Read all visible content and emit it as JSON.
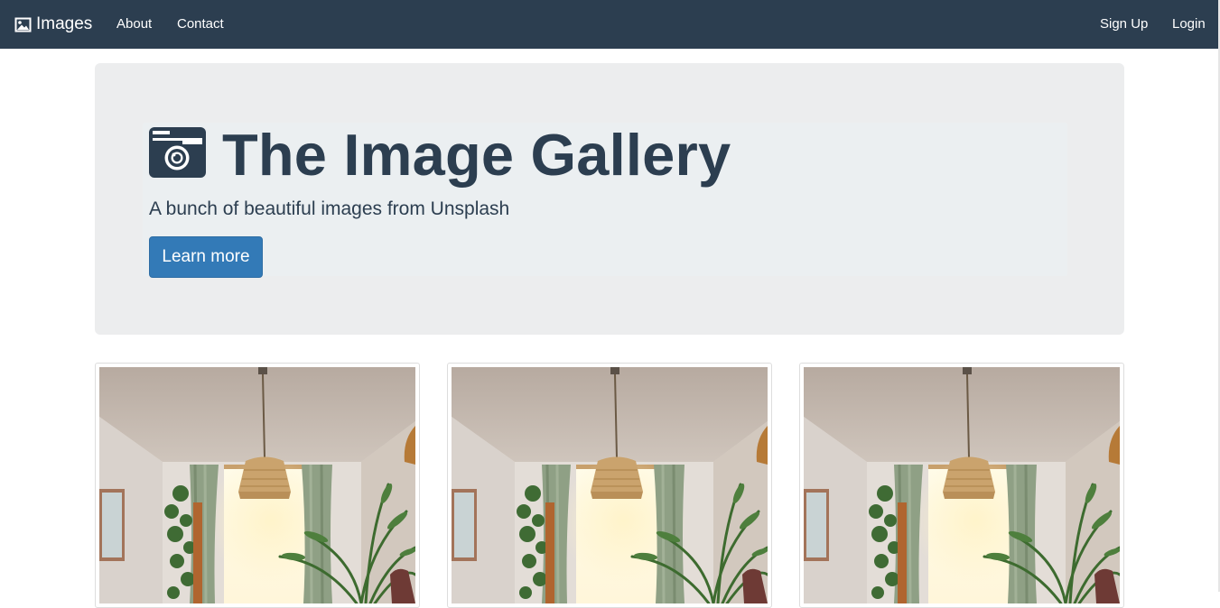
{
  "navbar": {
    "brand_icon": "image-icon",
    "brand_label": "Images",
    "links": [
      {
        "label": "About"
      },
      {
        "label": "Contact"
      }
    ],
    "right_links": [
      {
        "label": "Sign Up"
      },
      {
        "label": "Login"
      }
    ]
  },
  "jumbotron": {
    "icon": "camera-icon",
    "title": "The Image Gallery",
    "subtitle": "A bunch of beautiful images from Unsplash",
    "button_label": "Learn more"
  },
  "gallery": {
    "images": [
      {
        "subject": "interior-room-photo"
      },
      {
        "subject": "interior-room-photo"
      },
      {
        "subject": "interior-room-photo"
      }
    ]
  },
  "colors": {
    "navbar_bg": "#2c3e50",
    "title_color": "#2c3e50",
    "button_bg": "#337ab7",
    "jumbotron_bg": "#ecedee"
  }
}
